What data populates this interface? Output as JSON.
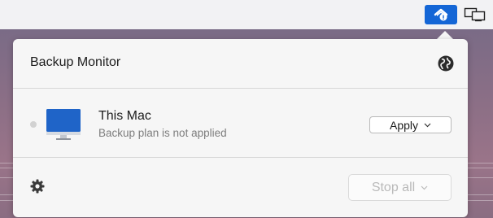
{
  "menubar": {
    "backup_icon": "backup-shield-icon",
    "display_icon": "display-mirroring-icon",
    "accent": "#1466d6"
  },
  "popover": {
    "title": "Backup Monitor",
    "header_icon": "globe-icon",
    "computer": {
      "name": "This Mac",
      "status": "Backup plan is not applied",
      "status_dot_color": "#d2d2d2",
      "icon": "imac-icon",
      "apply_label": "Apply"
    },
    "footer": {
      "settings_icon": "gear-icon",
      "stop_all_label": "Stop all"
    }
  }
}
